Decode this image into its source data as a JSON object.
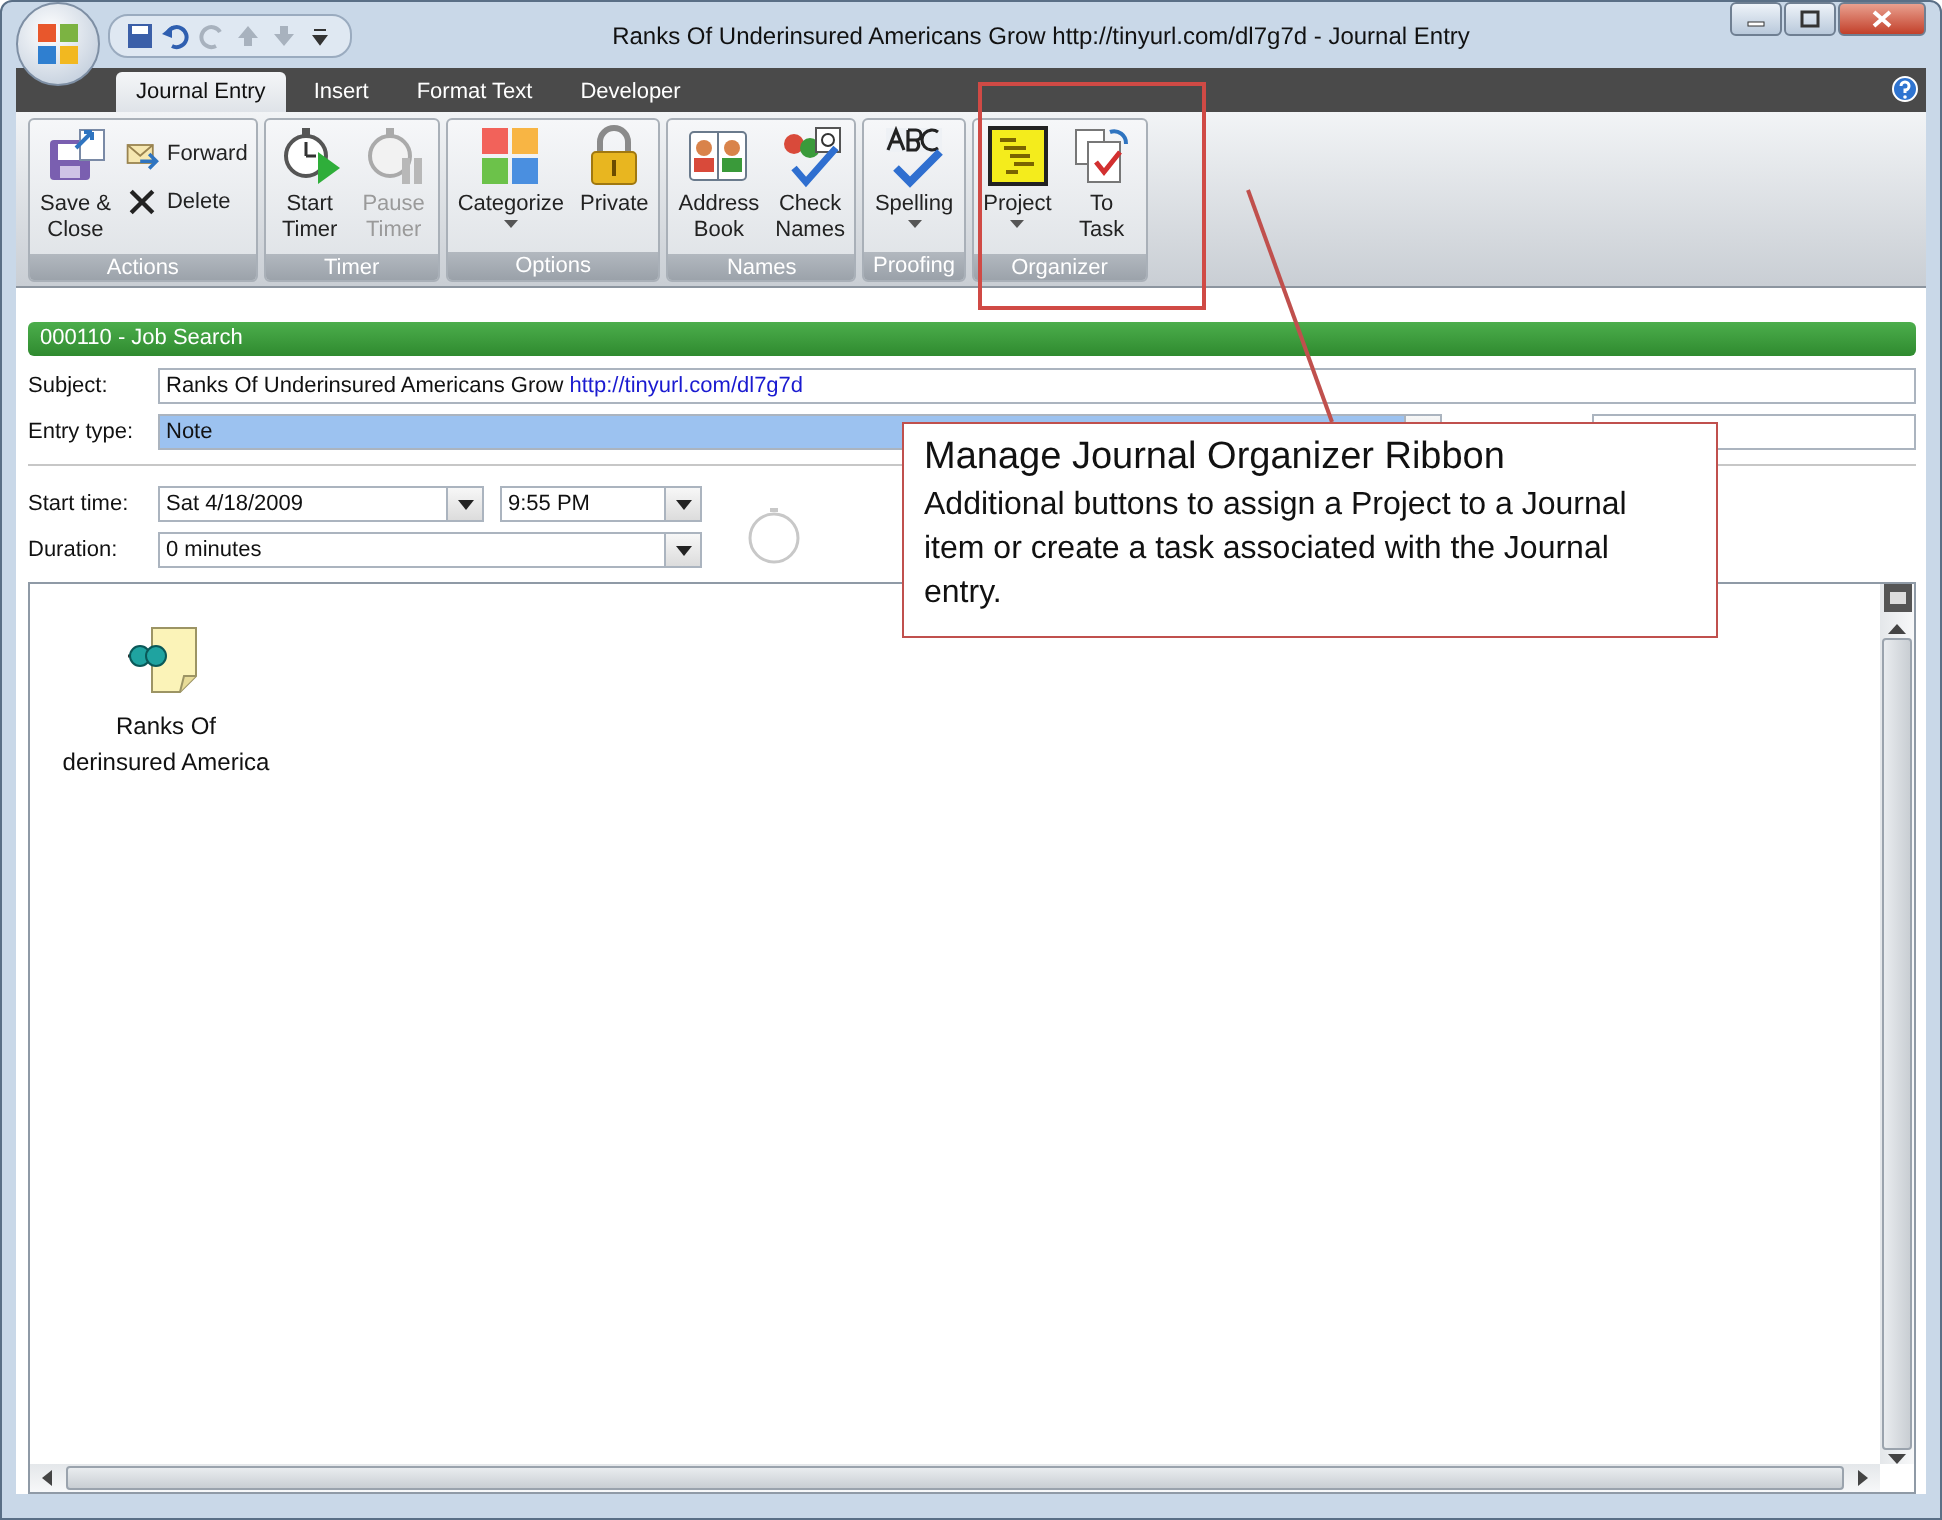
{
  "window": {
    "title": "Ranks Of Underinsured Americans Grow http://tinyurl.com/dl7g7d - Journal Entry"
  },
  "tabs": [
    {
      "label": "Journal Entry",
      "selected": true
    },
    {
      "label": "Insert",
      "selected": false
    },
    {
      "label": "Format Text",
      "selected": false
    },
    {
      "label": "Developer",
      "selected": false
    }
  ],
  "ribbon": {
    "groups": [
      {
        "label": "Actions",
        "buttons": [
          {
            "kind": "large",
            "label": "Save &\nClose",
            "disabled": false,
            "dropdown": false
          },
          {
            "kind": "small",
            "label": "Forward",
            "disabled": false
          },
          {
            "kind": "small",
            "label": "Delete",
            "disabled": false
          }
        ]
      },
      {
        "label": "Timer",
        "buttons": [
          {
            "kind": "large",
            "label": "Start\nTimer",
            "disabled": false,
            "dropdown": false
          },
          {
            "kind": "large",
            "label": "Pause\nTimer",
            "disabled": true,
            "dropdown": false
          }
        ]
      },
      {
        "label": "Options",
        "buttons": [
          {
            "kind": "large",
            "label": "Categorize",
            "disabled": false,
            "dropdown": true
          },
          {
            "kind": "large",
            "label": "Private",
            "disabled": false,
            "dropdown": false
          }
        ]
      },
      {
        "label": "Names",
        "buttons": [
          {
            "kind": "large",
            "label": "Address\nBook",
            "disabled": false,
            "dropdown": false
          },
          {
            "kind": "large",
            "label": "Check\nNames",
            "disabled": false,
            "dropdown": false
          }
        ]
      },
      {
        "label": "Proofing",
        "buttons": [
          {
            "kind": "large",
            "label": "Spelling",
            "disabled": false,
            "dropdown": true
          }
        ]
      },
      {
        "label": "Organizer",
        "buttons": [
          {
            "kind": "large",
            "label": "Project",
            "disabled": false,
            "dropdown": true
          },
          {
            "kind": "large",
            "label": "To\nTask",
            "disabled": false,
            "dropdown": false
          }
        ]
      }
    ]
  },
  "journal": {
    "header": "000110 - Job Search",
    "subject": {
      "label": "Subject:",
      "text": "Ranks Of Underinsured Americans Grow",
      "link": "http://tinyurl.com/dl7g7d"
    },
    "entry_type": {
      "label": "Entry type:",
      "value": "Note",
      "selected": true
    },
    "start_time": {
      "label": "Start time:",
      "date": "Sat 4/18/2009",
      "time": "9:55 PM"
    },
    "duration": {
      "label": "Duration:",
      "value": "0 minutes"
    },
    "attachment": {
      "lines": [
        "Ranks Of",
        "derinsured America"
      ]
    }
  },
  "callout": {
    "title": "Manage Journal Organizer Ribbon",
    "body": "Additional buttons to assign a Project to a Journal item or create a task associated with the Journal entry."
  }
}
